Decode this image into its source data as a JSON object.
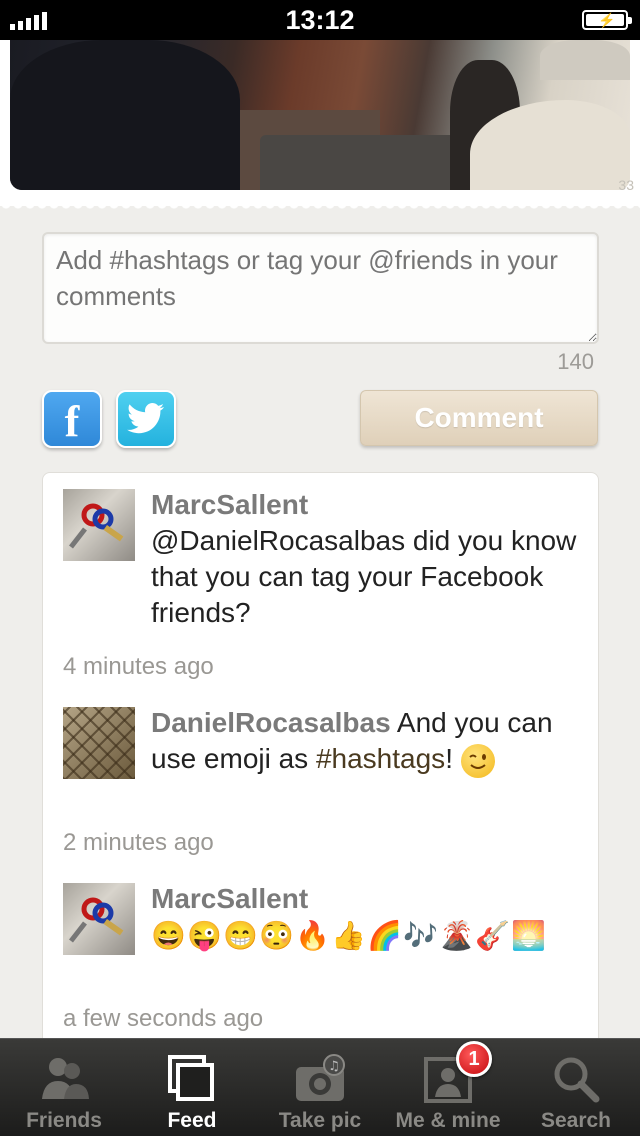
{
  "status_bar": {
    "time": "13:12"
  },
  "photo": {
    "count_label": "33"
  },
  "comment_input": {
    "placeholder": "Add #hashtags or tag your @friends in your comments"
  },
  "char_count": "140",
  "share": {
    "facebook_glyph": "f",
    "twitter_icon": "twitter-bird-icon"
  },
  "comment_button": "Comment",
  "comments": [
    {
      "user": "MarcSallent",
      "mention": "@DanielRocasalbas",
      "text": " did you know that you can tag your Facebook friends?",
      "time": "4 minutes ago"
    },
    {
      "user": "DanielRocasalbas",
      "text_before": " And you can use emoji as ",
      "hashtag": "#hashtags",
      "text_after": "!",
      "time": "2 minutes ago"
    },
    {
      "user": "MarcSallent",
      "emoji": [
        "😄",
        "😜",
        "😁",
        "😳",
        "🔥",
        "👍",
        "🌈",
        "🎶",
        "🌋",
        "🎸",
        "🌅"
      ],
      "time": "a few seconds ago"
    }
  ],
  "tabs": [
    {
      "label": "Friends",
      "icon": "friends-icon",
      "active": false
    },
    {
      "label": "Feed",
      "icon": "feed-icon",
      "active": true
    },
    {
      "label": "Take pic",
      "icon": "camera-icon",
      "active": false
    },
    {
      "label": "Me & mine",
      "icon": "profile-icon",
      "active": false,
      "badge": "1"
    },
    {
      "label": "Search",
      "icon": "search-icon",
      "active": false
    }
  ]
}
